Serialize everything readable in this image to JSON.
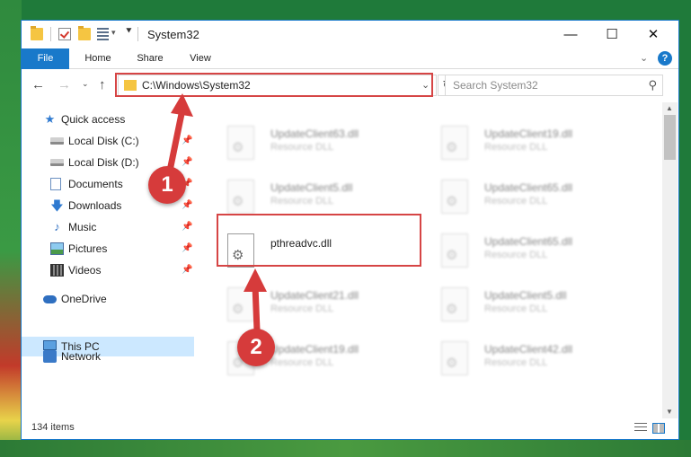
{
  "window": {
    "title": "System32",
    "minimize": "—",
    "maximize": "☐",
    "close": "✕"
  },
  "ribbon": {
    "tabs": [
      "File",
      "Home",
      "Share",
      "View"
    ],
    "help": "?"
  },
  "address": {
    "path": "C:\\Windows\\System32",
    "search_placeholder": "Search System32"
  },
  "nav": {
    "items": [
      {
        "label": "Quick access",
        "icon": "star-icon",
        "pinned": false
      },
      {
        "label": "Local Disk (C:)",
        "icon": "disk-icon",
        "pinned": true
      },
      {
        "label": "Local Disk (D:)",
        "icon": "disk-icon",
        "pinned": true
      },
      {
        "label": "Documents",
        "icon": "document-icon",
        "pinned": true
      },
      {
        "label": "Downloads",
        "icon": "download-icon",
        "pinned": true
      },
      {
        "label": "Music",
        "icon": "music-icon",
        "pinned": true
      },
      {
        "label": "Pictures",
        "icon": "pictures-icon",
        "pinned": true
      },
      {
        "label": "Videos",
        "icon": "videos-icon",
        "pinned": true
      },
      {
        "label": "OneDrive",
        "icon": "onedrive-icon",
        "pinned": false
      },
      {
        "label": "This PC",
        "icon": "this-pc-icon",
        "pinned": false,
        "selected": true
      },
      {
        "label": "Network",
        "icon": "network-icon",
        "pinned": false
      }
    ]
  },
  "files": {
    "left": [
      {
        "name": "UpdateClient63.dll",
        "type": "Resource DLL"
      },
      {
        "name": "UpdateClient5.dll",
        "type": "Resource DLL"
      },
      {
        "name": "pthreadvc.dll",
        "type": ""
      },
      {
        "name": "UpdateClient21.dll",
        "type": "Resource DLL"
      },
      {
        "name": "UpdateClient19.dll",
        "type": "Resource DLL"
      }
    ],
    "right": [
      {
        "name": "UpdateClient19.dll",
        "type": "Resource DLL"
      },
      {
        "name": "UpdateClient65.dll",
        "type": "Resource DLL"
      },
      {
        "name": "UpdateClient65.dll",
        "type": "Resource DLL"
      },
      {
        "name": "UpdateClient5.dll",
        "type": "Resource DLL"
      },
      {
        "name": "UpdateClient42.dll",
        "type": "Resource DLL"
      }
    ]
  },
  "status": {
    "items_count": "134 items"
  },
  "annotations": {
    "step1": "1",
    "step2": "2",
    "color": "#d63b3b"
  },
  "colors": {
    "accent": "#1979ca",
    "selection": "#cce8ff",
    "highlight": "#d64545"
  }
}
